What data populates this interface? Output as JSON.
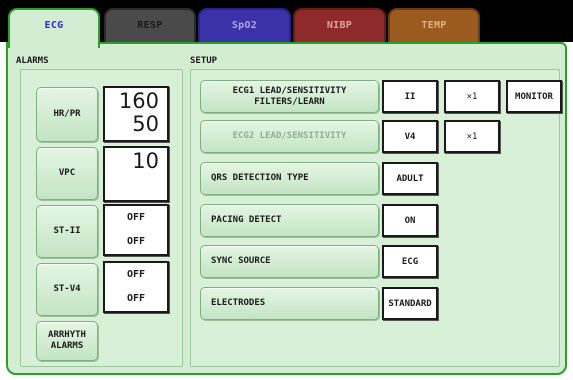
{
  "tabs": [
    {
      "label": "ECG"
    },
    {
      "label": "RESP"
    },
    {
      "label": "SpO2"
    },
    {
      "label": "NIBP"
    },
    {
      "label": "TEMP"
    }
  ],
  "alarms": {
    "title": "ALARMS",
    "hr_pr": {
      "label": "HR/PR",
      "upper": "160",
      "lower": "50"
    },
    "vpc": {
      "label": "VPC",
      "value": "10"
    },
    "st_ii": {
      "label": "ST-II",
      "upper": "OFF",
      "lower": "OFF"
    },
    "st_v4": {
      "label": "ST-V4",
      "upper": "OFF",
      "lower": "OFF"
    },
    "arrhythmia": {
      "label_line1": "ARRHYTH",
      "label_line2": "ALARMS"
    }
  },
  "setup": {
    "title": "SETUP",
    "ecg1": {
      "label_line1": "ECG1 LEAD/SENSITIVITY",
      "label_line2": "FILTERS/LEARN",
      "lead": "II",
      "sensitivity": "×1",
      "filter": "MONITOR"
    },
    "ecg2": {
      "label": "ECG2 LEAD/SENSITIVITY",
      "lead": "V4",
      "sensitivity": "×1"
    },
    "qrs": {
      "label": "QRS DETECTION TYPE",
      "value": "ADULT"
    },
    "pacing": {
      "label": "PACING DETECT",
      "value": "ON"
    },
    "sync": {
      "label": "SYNC SOURCE",
      "value": "ECG"
    },
    "electrodes": {
      "label": "ELECTRODES",
      "value": "STANDARD"
    }
  }
}
